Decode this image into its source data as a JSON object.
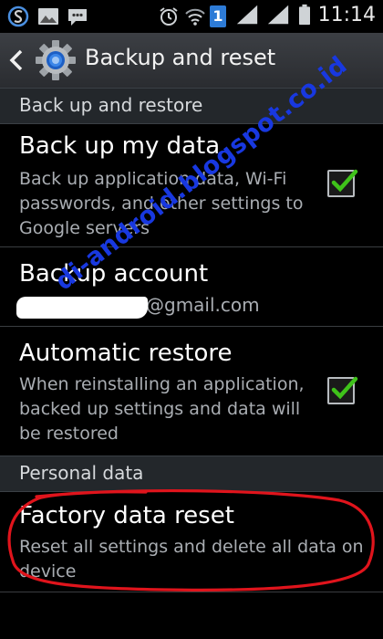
{
  "status_bar": {
    "time": "11:14",
    "notification_count": "1",
    "icons": [
      "s-note-icon",
      "gallery-icon",
      "chat-icon",
      "alarm-icon",
      "wifi-icon",
      "notification-badge-icon",
      "signal-icon",
      "signal-icon",
      "battery-icon"
    ]
  },
  "action_bar": {
    "title": "Backup and reset",
    "icons": [
      "back-arrow-icon",
      "settings-gear-icon"
    ]
  },
  "sections": {
    "backup_restore": "Back up and restore",
    "personal_data": "Personal data"
  },
  "items": {
    "backup_data": {
      "title": "Back up my data",
      "summary": "Back up application data, Wi-Fi passwords, and other settings to Google servers",
      "checked": true
    },
    "backup_account": {
      "title": "Backup account",
      "email_visible": "@gmail.com"
    },
    "auto_restore": {
      "title": "Automatic restore",
      "summary": "When reinstalling an application, backed up settings and data will be restored",
      "checked": true
    },
    "factory_reset": {
      "title": "Factory data reset",
      "summary": "Reset all settings and delete all data on device"
    }
  },
  "watermark": "di-android.blogspot.co.id",
  "colors": {
    "checkmark": "#3fc21a",
    "annotation": "#e0141c",
    "watermark": "#1838e0"
  }
}
